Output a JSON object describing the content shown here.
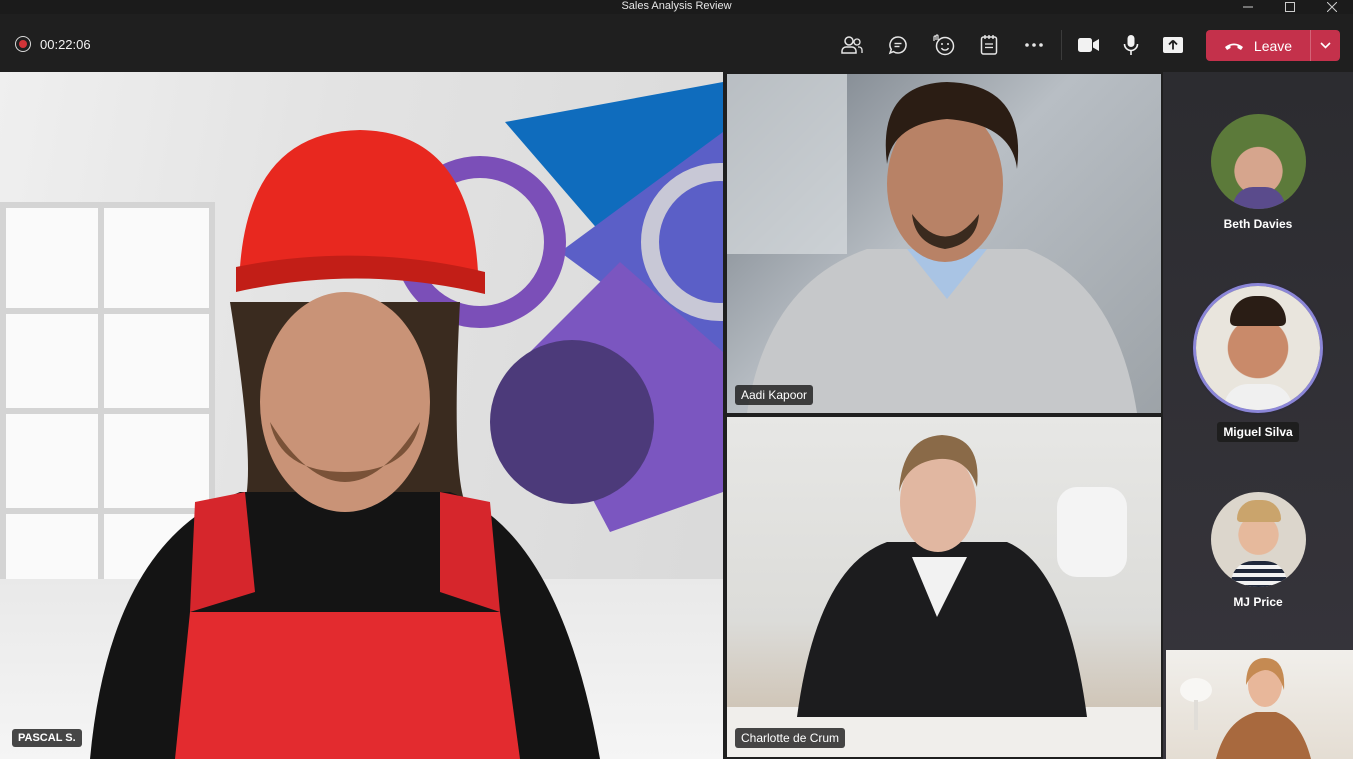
{
  "window": {
    "title": "Sales Analysis Review"
  },
  "toolbar": {
    "timer": "00:22:06",
    "leave_label": "Leave",
    "icons": [
      "people-icon",
      "chat-icon",
      "reactions-icon",
      "notes-icon",
      "more-icon",
      "camera-icon",
      "mic-icon",
      "share-icon"
    ],
    "accent": "#c4314b"
  },
  "stage": {
    "main": {
      "name": "PASCAL S."
    },
    "tiles": [
      {
        "name": "Aadi Kapoor"
      },
      {
        "name": "Charlotte de Crum"
      }
    ]
  },
  "roster": [
    {
      "name": "Beth Davies"
    },
    {
      "name": "Miguel Silva"
    },
    {
      "name": "MJ Price"
    }
  ],
  "colors": {
    "speaking_ring": "#8b86d8",
    "recording": "#d13438"
  }
}
